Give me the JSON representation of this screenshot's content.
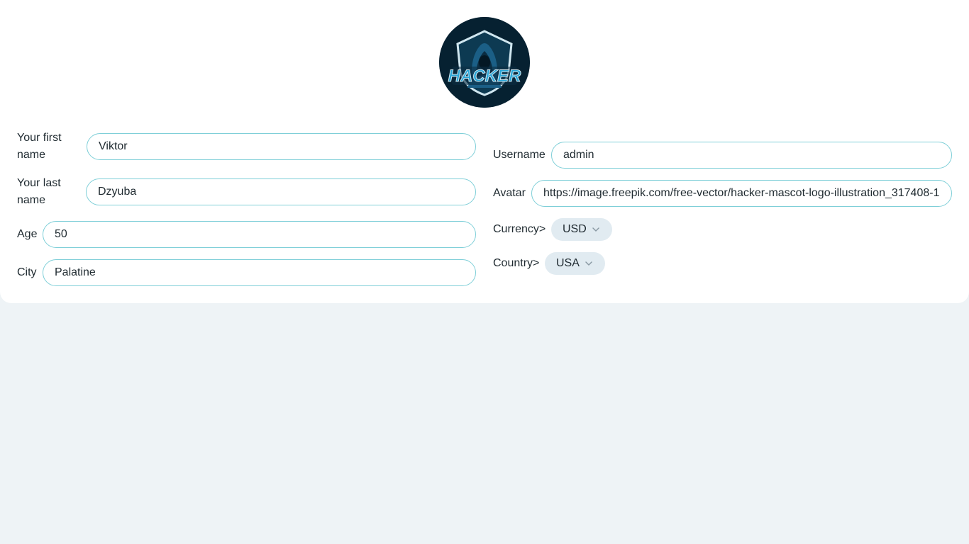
{
  "profile": {
    "avatar_alt": "HACKER",
    "avatar_text": "HACKER"
  },
  "form": {
    "first_name": {
      "label": "Your first name",
      "value": "Viktor"
    },
    "last_name": {
      "label": "Your last name",
      "value": "Dzyuba"
    },
    "age": {
      "label": "Age",
      "value": "50"
    },
    "city": {
      "label": "City",
      "value": "Palatine"
    },
    "username": {
      "label": "Username",
      "value": "admin"
    },
    "avatar_url": {
      "label": "Avatar",
      "value": "https://image.freepik.com/free-vector/hacker-mascot-logo-illustration_317408-1"
    },
    "currency": {
      "label": "Currency>",
      "selected": "USD"
    },
    "country": {
      "label": "Country>",
      "selected": "USA"
    }
  },
  "icons": {
    "select_chevron": "chevron-down-icon"
  },
  "colors": {
    "page_bg": "#eef3f6",
    "card_bg": "#ffffff",
    "input_border": "#7fcfd8",
    "select_bg": "#e1ebf1",
    "avatar_bg": "#062131",
    "logo_accent": "#2aa7d8"
  }
}
